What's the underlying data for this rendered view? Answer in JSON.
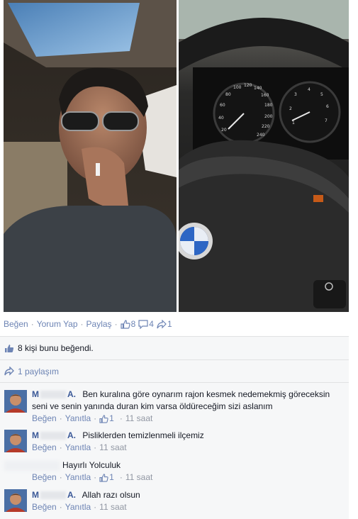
{
  "photos": {
    "left": {
      "description_icon": "selfie-photo"
    },
    "right": {
      "description_icon": "steering-wheel-photo",
      "speedo_ticks": [
        "20",
        "40",
        "60",
        "80",
        "100",
        "120",
        "140",
        "160",
        "180",
        "200",
        "220",
        "240"
      ],
      "tacho_ticks": [
        "1",
        "2",
        "3",
        "4",
        "5",
        "6",
        "7"
      ],
      "badge": "BMW"
    }
  },
  "actions": {
    "like_label": "Beğen",
    "comment_label": "Yorum Yap",
    "share_label": "Paylaş",
    "like_count": "8",
    "comment_count": "4",
    "share_count": "1"
  },
  "likes_summary": {
    "text": "8 kişi bunu beğendi."
  },
  "shares_summary": {
    "text": "1 paylaşım"
  },
  "colors": {
    "link": "#6d84b4",
    "author": "#3b5998",
    "panel": "#f6f7f8",
    "border": "#e1e2e3"
  },
  "comments": [
    {
      "author_start": "M",
      "author_end": "A.",
      "text": "Ben kuralına göre oynarım rajon kesmek nedemekmiş göreceksin seni ve senin yanında duran kim varsa öldüreceğim sizi aslanım",
      "like_label": "Beğen",
      "reply_label": "Yanıtla",
      "likes": "1",
      "time": "11 saat"
    },
    {
      "author_start": "M",
      "author_end": "A.",
      "text": "Pisliklerden temizlenmeli ilçemiz",
      "like_label": "Beğen",
      "reply_label": "Yanıtla",
      "time": "11 saat"
    },
    {
      "text": "Hayırlı Yolculuk",
      "like_label": "Beğen",
      "reply_label": "Yanıtla",
      "likes": "1",
      "time": "11 saat"
    },
    {
      "author_start": "M",
      "author_end": "A.",
      "text": "Allah razı olsun",
      "like_label": "Beğen",
      "reply_label": "Yanıtla",
      "time": "11 saat"
    }
  ]
}
